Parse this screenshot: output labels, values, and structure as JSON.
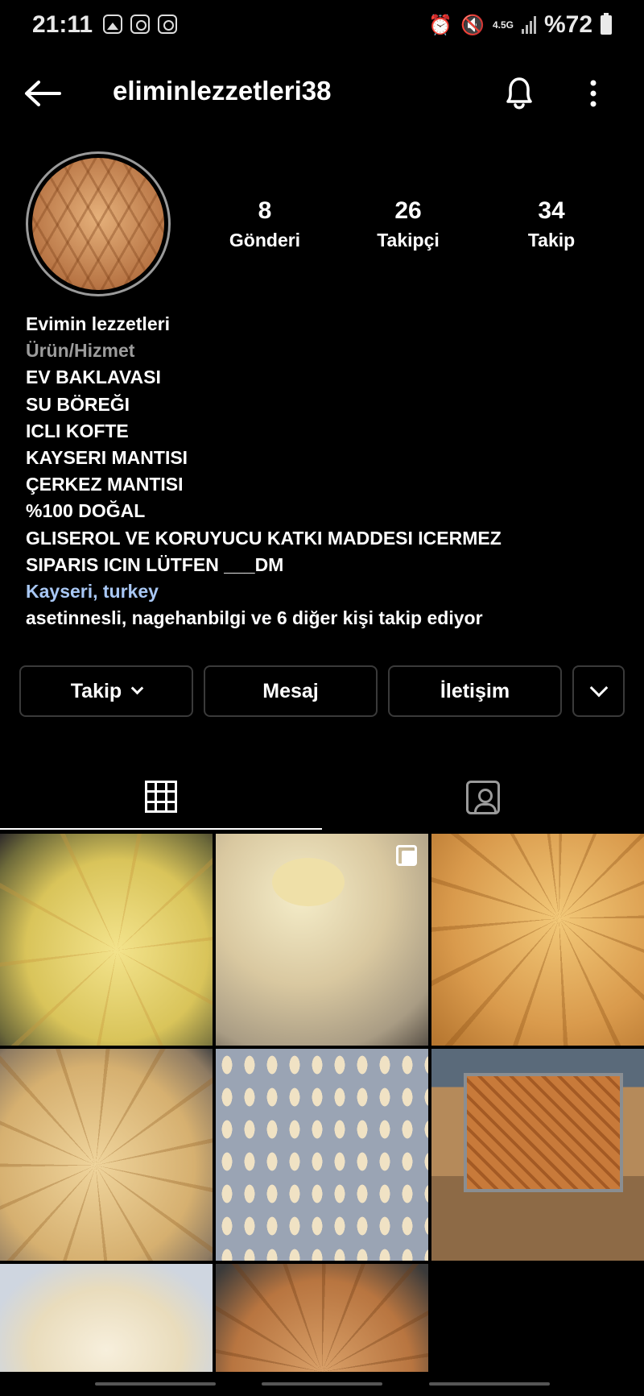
{
  "status_bar": {
    "time": "21:11",
    "network": "4.5G",
    "battery": "%72",
    "icons": [
      "gallery-icon",
      "instagram-icon",
      "instagram-icon",
      "alarm-icon",
      "mute-icon",
      "signal-icon",
      "battery-icon"
    ]
  },
  "header": {
    "username": "eliminlezzetleri38",
    "icons": [
      "back-arrow-icon",
      "bell-icon",
      "more-vertical-icon"
    ]
  },
  "profile": {
    "stats": [
      {
        "value": "8",
        "label": "Gönderi"
      },
      {
        "value": "26",
        "label": "Takipçi"
      },
      {
        "value": "34",
        "label": "Takip"
      }
    ],
    "name": "Evimin lezzetleri",
    "category": "Ürün/Hizmet",
    "bio_lines": [
      "EV BAKLAVASI",
      "SU BÖREĞI",
      "ICLI KOFTE",
      "KAYSERI MANTISI",
      "ÇERKEZ MANTISI",
      "%100 DOĞAL",
      "GLISEROL VE KORUYUCU KATKI MADDESI ICERMEZ",
      "SIPARIS ICIN LÜTFEN ___DM"
    ],
    "location": "Kayseri, turkey",
    "followed_by": "asetinnesli, nagehanbilgi ve 6 diğer kişi takip ediyor"
  },
  "actions": {
    "follow": "Takip",
    "message": "Mesaj",
    "contact": "İletişim"
  },
  "tabs": [
    "grid-icon",
    "tagged-icon"
  ],
  "posts": [
    {
      "subject": "su böreği",
      "multi": false
    },
    {
      "subject": "mantı",
      "multi": true
    },
    {
      "subject": "baklava",
      "multi": false
    },
    {
      "subject": "baklava",
      "multi": false
    },
    {
      "subject": "mantı",
      "multi": false
    },
    {
      "subject": "baklava tepsi",
      "multi": false
    },
    {
      "subject": "mantı",
      "multi": false
    },
    {
      "subject": "baklava",
      "multi": false
    }
  ],
  "colors": {
    "background": "#000000",
    "text": "#ffffff",
    "secondary_text": "#9c9c9c",
    "link": "#a9c8f5",
    "button_border": "#3a3a3a"
  }
}
